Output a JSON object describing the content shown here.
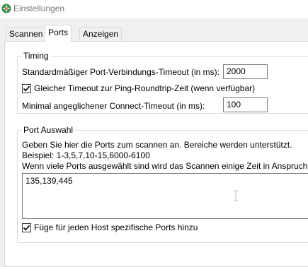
{
  "window": {
    "title": "Einstellungen",
    "icon": "app-logo-icon"
  },
  "tabs": [
    {
      "label": "Scannen",
      "active": false
    },
    {
      "label": "Ports",
      "active": true
    },
    {
      "label": "Anzeigen",
      "active": false
    }
  ],
  "timing": {
    "legend": "Timing",
    "port_timeout_label": "Standardmäßiger Port-Verbindungs-Timeout (in ms):",
    "port_timeout_value": "2000",
    "same_timeout_label": "Gleicher Timeout zur Ping-Roundtrip-Zeit (wenn verfügbar)",
    "same_timeout_checked": true,
    "min_timeout_label": "Minimal angeglichener Connect-Timeout (in ms):",
    "min_timeout_value": "100"
  },
  "port_selection": {
    "legend": "Port Auswahl",
    "help_line1": "Geben Sie hier die Ports zum scannen an. Bereiche werden unterstützt.",
    "help_line2": "Beispiel: 1-3,5,7,10-15,6000-6100",
    "help_line3": "Wenn viele Ports ausgewählt sind wird das Scannen einige Zeit in Anspruch n",
    "ports_value": "135,139,445",
    "host_specific_label": "Füge für jeden Host spezifische Ports hinzu",
    "host_specific_checked": true
  }
}
